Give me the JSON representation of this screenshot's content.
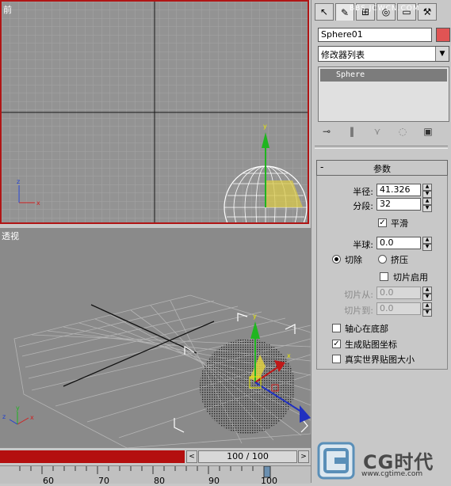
{
  "viewports": {
    "front": {
      "label": "前"
    },
    "perspective": {
      "label": "透视"
    }
  },
  "watermark": "BBS.JCWCN.COM",
  "panel": {
    "tabs": [
      "create-tab",
      "modify-tab",
      "hierarchy-tab",
      "motion-tab",
      "display-tab",
      "utilities-tab"
    ],
    "object_name": "Sphere01",
    "object_color": "#e05454",
    "modifier_list": "修改器列表",
    "stack_items": [
      "Sphere"
    ],
    "rollout": {
      "toggle": "-",
      "title": "参数"
    },
    "params": {
      "radius_label": "半径:",
      "radius_value": "41.326",
      "segments_label": "分段:",
      "segments_value": "32",
      "smooth_label": "平滑",
      "smooth_checked": true,
      "hemisphere_label": "半球:",
      "hemisphere_value": "0.0",
      "chop_label": "切除",
      "squash_label": "挤压",
      "selected_mode": "chop",
      "slice_on_label": "切片启用",
      "slice_from_label": "切片从:",
      "slice_from_value": "0.0",
      "slice_to_label": "切片到:",
      "slice_to_value": "0.0",
      "base_to_pivot_label": "轴心在底部",
      "base_to_pivot_checked": false,
      "gen_mapping_label": "生成贴图坐标",
      "gen_mapping_checked": true,
      "real_world_label": "真实世界贴图大小",
      "real_world_checked": false
    }
  },
  "timeline": {
    "frame_display": "100 / 100",
    "prev_btn": "<",
    "next_btn": ">",
    "ticks": [
      "60",
      "70",
      "80",
      "90",
      "100"
    ],
    "progress": 1.0,
    "highlight_color": "#b40f0f"
  },
  "logo": {
    "brand": "CG时代",
    "url": "www.cgtime.com"
  }
}
